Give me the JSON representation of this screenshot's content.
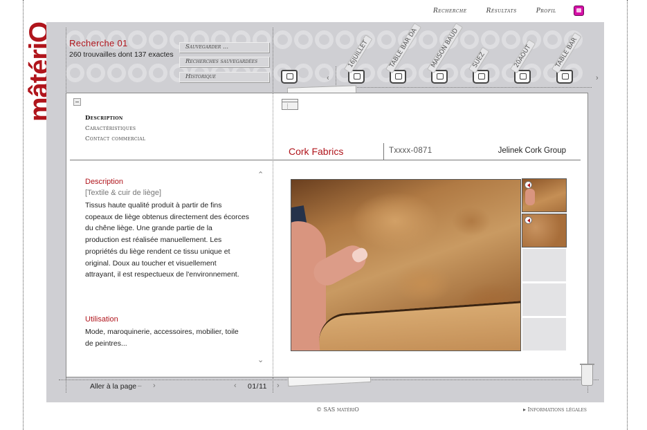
{
  "brand": {
    "logo_text": "mâtériO",
    "accent_color": "#b0151c"
  },
  "topnav": {
    "search": "Recherche",
    "results": "Résultats",
    "profile": "Profil"
  },
  "search": {
    "title": "Recherche 01",
    "summary": "260 trouvailles dont 137 exactes",
    "buttons": {
      "save": "Sauvegarder ...",
      "saved_searches": "Recherches sauvegardées",
      "history": "Historique"
    }
  },
  "carousel_tags": [
    "16JUILLET",
    "TABLE BAR DA",
    "MAISON BAUD",
    "SUEZ",
    "20AOUT",
    "TABLE BAR"
  ],
  "sidemenu": {
    "description": "Description",
    "features": "Caractéristiques",
    "contact": "Contact commercial"
  },
  "product": {
    "name": "Cork Fabrics",
    "reference": "Txxxx-0871",
    "company": "Jelinek Cork Group"
  },
  "description": {
    "heading": "Description",
    "category": "[Textile & cuir de liège]",
    "lines": [
      "Tissus haute qualité produit à partir de fins",
      "copeaux de liège obtenus directement des écorces",
      "du chêne liège. Une grande partie de la",
      "production est réalisée manuellement. Les",
      "propriétés  du liège rendent ce tissu unique et",
      "original. Doux au toucher et visuellement",
      "attrayant, il est respectueux de l'environnement."
    ]
  },
  "usage": {
    "heading": "Utilisation",
    "lines": [
      "Mode, maroquinerie, accessoires, mobilier, toile",
      "de peintres..."
    ]
  },
  "pagination": {
    "goto_label": "Aller à la page",
    "goto_dash": "–",
    "current": "01/11"
  },
  "footer": {
    "copyright": "© SAS matériO",
    "legal": "▸ Informations légales"
  }
}
